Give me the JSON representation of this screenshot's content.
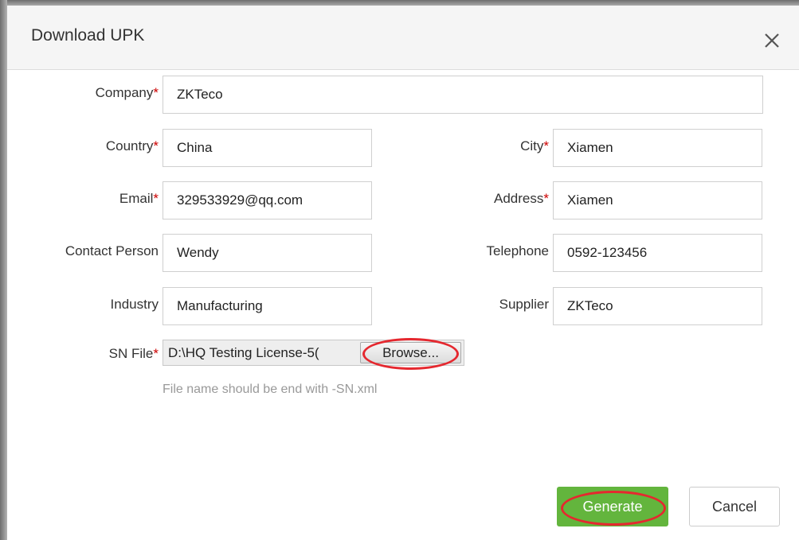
{
  "dialog": {
    "title": "Download UPK",
    "close_icon": "close-icon"
  },
  "form": {
    "required_mark": "*",
    "company": {
      "label": "Company",
      "value": "ZKTeco"
    },
    "country": {
      "label": "Country",
      "value": "China"
    },
    "city": {
      "label": "City",
      "value": "Xiamen"
    },
    "email": {
      "label": "Email",
      "value": "329533929@qq.com"
    },
    "address": {
      "label": "Address",
      "value": "Xiamen"
    },
    "contact_person": {
      "label": "Contact Person",
      "value": "Wendy"
    },
    "telephone": {
      "label": "Telephone",
      "value": "0592-123456"
    },
    "industry": {
      "label": "Industry",
      "value": "Manufacturing"
    },
    "supplier": {
      "label": "Supplier",
      "value": "ZKTeco"
    },
    "sn_file": {
      "label": "SN File",
      "value": "D:\\HQ Testing License-5(",
      "browse_label": "Browse...",
      "hint": "File name should be end with -SN.xml"
    }
  },
  "actions": {
    "generate_label": "Generate",
    "cancel_label": "Cancel"
  },
  "colors": {
    "primary_button": "#63b53d",
    "required": "#cc0000",
    "annotation": "#e5282f"
  }
}
